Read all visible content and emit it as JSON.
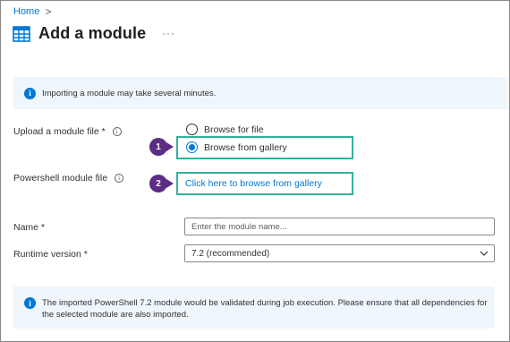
{
  "breadcrumb": {
    "home": "Home",
    "separator": ">"
  },
  "header": {
    "title": "Add a module",
    "more": "···",
    "icon": "module-grid-icon"
  },
  "info_banner": {
    "text": "Importing a module may take several minutes.",
    "icon": "info-icon"
  },
  "upload": {
    "label": "Upload a module file *",
    "options": [
      {
        "label": "Browse for file",
        "checked": false
      },
      {
        "label": "Browse from gallery",
        "checked": true
      }
    ]
  },
  "powershell": {
    "label": "Powershell module file",
    "link": "Click here to browse from gallery"
  },
  "name": {
    "label": "Name *",
    "placeholder": "Enter the module name..."
  },
  "runtime": {
    "label": "Runtime version *",
    "value": "7.2 (recommended)"
  },
  "steps": {
    "one": "1",
    "two": "2"
  },
  "bottom_banner": {
    "text": "The imported PowerShell 7.2 module would be validated during job execution. Please ensure that all dependencies for the selected module are also imported."
  },
  "colors": {
    "accent": "#0078d4",
    "highlight": "#33b29a",
    "step_badge": "#5b2c83",
    "banner_bg": "#eff6fc"
  }
}
